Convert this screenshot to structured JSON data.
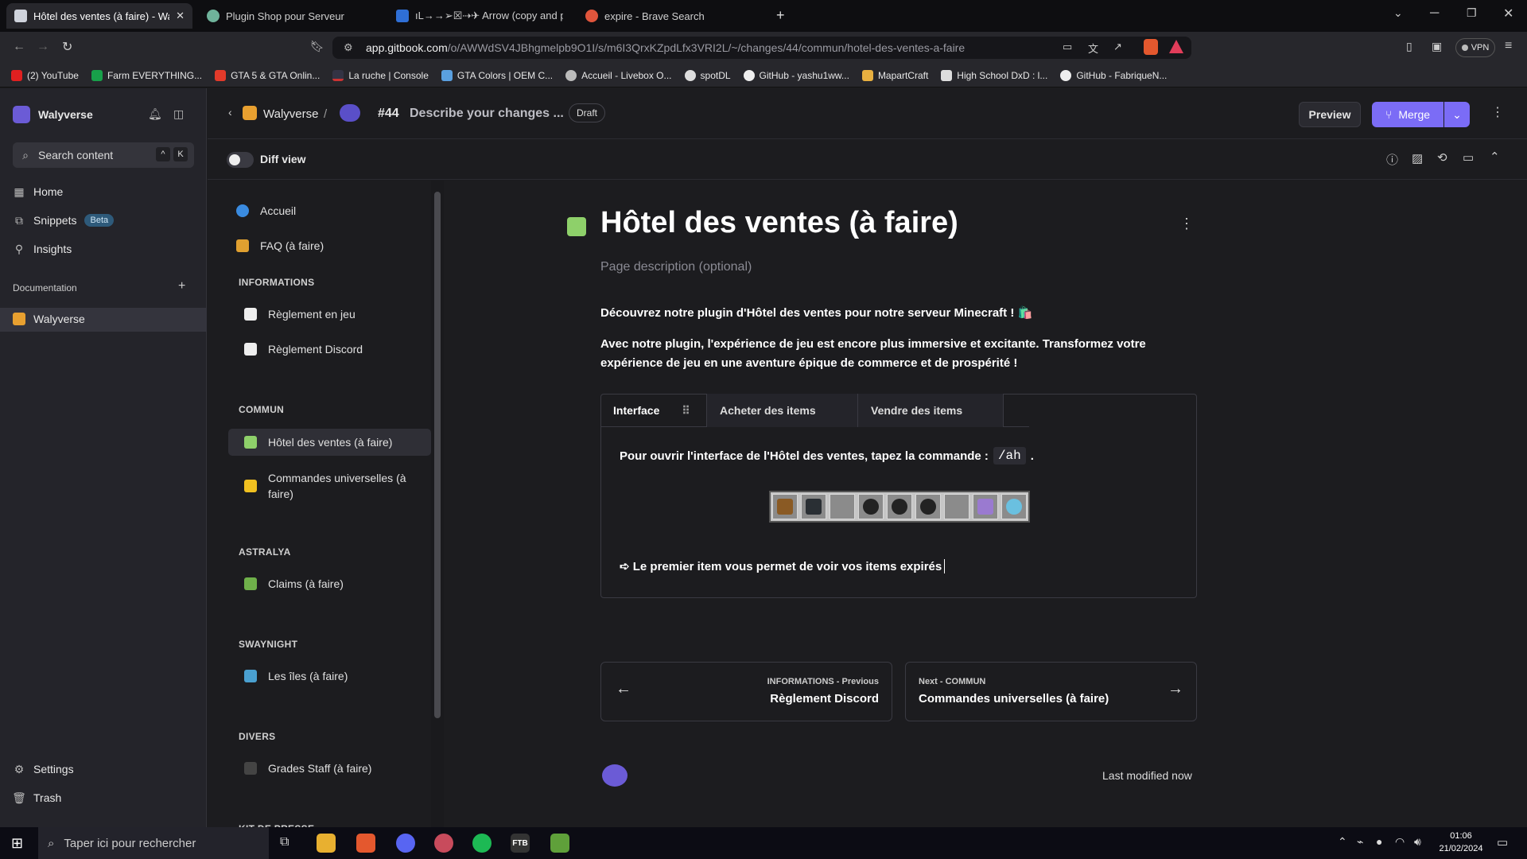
{
  "browser": {
    "tabs": [
      {
        "title": "Hôtel des ventes (à faire) - Waly",
        "active": true
      },
      {
        "title": "Plugin Shop pour Serveur"
      },
      {
        "title": "ıL→→➢☒⇢✈ Arrow (copy and pa"
      },
      {
        "title": "expire - Brave Search"
      }
    ],
    "url_domain": "app.gitbook.com",
    "url_path": "/o/AWWdSV4JBhgmelpb9O1I/s/m6I3QrxKZpdLfx3VRI2L/~/changes/44/commun/hotel-des-ventes-a-faire",
    "vpn_label": "VPN",
    "bookmarks": [
      "(2) YouTube",
      "Farm EVERYTHING...",
      "GTA 5 & GTA Onlin...",
      "La ruche | Console",
      "GTA Colors | OEM C...",
      "Accueil - Livebox O...",
      "spotDL",
      "GitHub - yashu1ww...",
      "MapartCraft",
      "High School DxD : l...",
      "GitHub - FabriqueN..."
    ]
  },
  "sidebar": {
    "org_name": "Walyverse",
    "search_placeholder": "Search content",
    "shortcut_keys": [
      "^",
      "K"
    ],
    "nav": [
      {
        "label": "Home",
        "icon": "home-grid-icon"
      },
      {
        "label": "Snippets",
        "icon": "snippets-icon",
        "badge": "Beta"
      },
      {
        "label": "Insights",
        "icon": "insights-icon"
      }
    ],
    "section_label": "Documentation",
    "space_name": "Walyverse",
    "bottom": [
      {
        "label": "Settings",
        "icon": "gear-icon"
      },
      {
        "label": "Trash",
        "icon": "trash-icon"
      }
    ]
  },
  "topbar": {
    "breadcrumb_space": "Walyverse",
    "breadcrumb_sep": "/",
    "change_number": "#44",
    "change_title": "Describe your changes ...",
    "draft_badge": "Draft",
    "preview_label": "Preview",
    "merge_label": "Merge"
  },
  "diff": {
    "label": "Diff view"
  },
  "page_nav": {
    "items": [
      {
        "type": "item",
        "label": "Accueil"
      },
      {
        "type": "item",
        "label": "FAQ (à faire)"
      },
      {
        "type": "section",
        "label": "INFORMATIONS"
      },
      {
        "type": "item",
        "label": "Règlement en jeu"
      },
      {
        "type": "item",
        "label": "Règlement Discord"
      },
      {
        "type": "section",
        "label": "COMMUN"
      },
      {
        "type": "item",
        "label": "Hôtel des ventes (à faire)",
        "active": true
      },
      {
        "type": "item",
        "label": "Commandes universelles (à faire)"
      },
      {
        "type": "section",
        "label": "ASTRALYA"
      },
      {
        "type": "item",
        "label": "Claims (à faire)"
      },
      {
        "type": "section",
        "label": "SWAYNIGHT"
      },
      {
        "type": "item",
        "label": "Les îles (à faire)"
      },
      {
        "type": "section",
        "label": "DIVERS"
      },
      {
        "type": "item",
        "label": "Grades Staff (à faire)"
      }
    ],
    "cut_section": "KIT DE PRESSE"
  },
  "page": {
    "title": "Hôtel des ventes (à faire)",
    "description_placeholder": "Page description (optional)",
    "para1": "Découvrez notre plugin d'Hôtel des ventes  pour notre serveur Minecraft ! 🛍️",
    "para2": "Avec notre plugin, l'expérience de jeu est encore plus immersive et excitante. Transformez votre expérience de jeu en une aventure épique de commerce et de prospérité !",
    "tabs": [
      "Interface",
      "Acheter des items",
      "Vendre des items"
    ],
    "tab_text": "Pour ouvrir l'interface de l'Hôtel des ventes, tapez la commande :",
    "command": "/ah",
    "tab_text_end": ".",
    "bullet": "➪ Le premier item vous permet de voir vos items expirés",
    "prev": {
      "kicker": "INFORMATIONS - Previous",
      "title": "Règlement Discord"
    },
    "next": {
      "kicker": "Next - COMMUN",
      "title": "Commandes universelles (à faire)"
    },
    "last_modified": "Last modified now"
  },
  "taskbar": {
    "search_placeholder": "Taper ici pour rechercher",
    "time": "01:06",
    "date": "21/02/2024"
  },
  "colors": {
    "accent": "#7b6cf6",
    "bg": "#1c1c1f",
    "sidebar": "#24242a"
  }
}
